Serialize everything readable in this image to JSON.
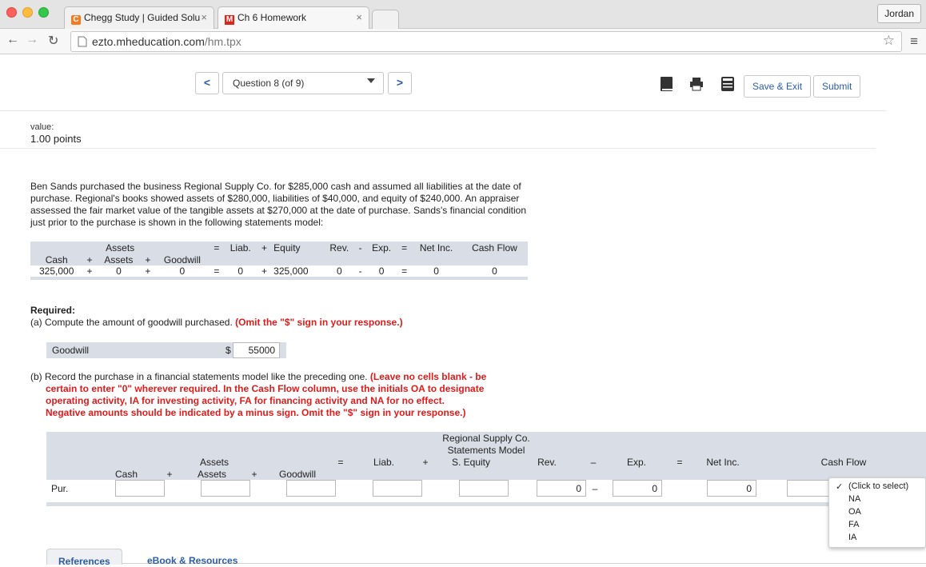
{
  "browser": {
    "tabs": [
      {
        "label": "Chegg Study | Guided Solu",
        "favicon": "C"
      },
      {
        "label": "Ch 6 Homework",
        "favicon": "M"
      }
    ],
    "url_domain": "ezto.mheducation.com",
    "url_path": "/hm.tpx",
    "user": "Jordan",
    "colors": {
      "close": "#fc605c",
      "minimize": "#fdbc40",
      "maximize": "#34c84a",
      "chegg": "#f47b20",
      "mh": "#e2231a"
    }
  },
  "toolbar": {
    "prev": "<",
    "next": ">",
    "question": "Question 8 (of 9)",
    "save_exit": "Save & Exit",
    "submit": "Submit",
    "icons": [
      "ebook-icon",
      "print-icon",
      "calculator-icon"
    ]
  },
  "value": {
    "label": "value:",
    "points": "1.00 points"
  },
  "problem": "Ben Sands purchased the business Regional Supply Co. for $285,000 cash and assumed all liabilities at the date of purchase. Regional's books showed assets of $280,000, liabilities of $40,000, and equity of $240,000. An appraiser assessed the fair market value of the tangible assets at $270,000 at the date of purchase. Sands's financial condition just prior to the purchase is shown in the following statements model:",
  "model": {
    "row1": [
      "Assets",
      "=",
      "Liab.",
      "+",
      "Equity",
      "Rev.",
      "-",
      "Exp.",
      "=",
      "Net Inc.",
      "Cash Flow"
    ],
    "row2": [
      "Cash",
      "+",
      "Assets",
      "+",
      "Goodwill"
    ],
    "row3": [
      "325,000",
      "+",
      "0",
      "+",
      "0",
      "=",
      "0",
      "+",
      "325,000",
      "0",
      "-",
      "0",
      "=",
      "0",
      "0"
    ]
  },
  "required": {
    "heading": "Required:",
    "a_text": "(a) Compute the amount of goodwill purchased.",
    "a_note": "(Omit the \"$\" sign in your response.)",
    "goodwill_label": "Goodwill",
    "currency": "$",
    "goodwill_value": "55000",
    "b_text": "(b) Record the purchase in a financial statements model like the preceding one.",
    "b_note_1": "(Leave no cells blank - be",
    "b_note_2": "certain to enter \"0\" wherever required. In the Cash Flow column, use the initials OA to designate",
    "b_note_3": "operating activity, IA for investing activity, FA for financing activity and NA for no effect.",
    "b_note_4": "Negative amounts should be indicated by a minus sign. Omit the \"$\" sign in your response.)"
  },
  "b_table": {
    "company_1": "Regional Supply Co.",
    "company_2": "Statements Model",
    "assets": "Assets",
    "eq1": "=",
    "liab": "Liab.",
    "plus1": "+",
    "s_equity": "S. Equity",
    "rev": "Rev.",
    "minus": "–",
    "exp": "Exp.",
    "eq2": "=",
    "net_inc": "Net Inc.",
    "cash_flow": "Cash Flow",
    "cash": "Cash",
    "plus2": "+",
    "assets2": "Assets",
    "plus3": "+",
    "goodwill": "Goodwill",
    "row_label": "Pur.",
    "rev_value": "0",
    "row_minus": "–",
    "exp_value": "0",
    "net_value": "0"
  },
  "dropdown": {
    "check": "✓",
    "options": [
      "(Click to select)",
      "NA",
      "OA",
      "FA",
      "IA"
    ]
  },
  "bottom_tabs": [
    "References",
    "eBook & Resources"
  ]
}
